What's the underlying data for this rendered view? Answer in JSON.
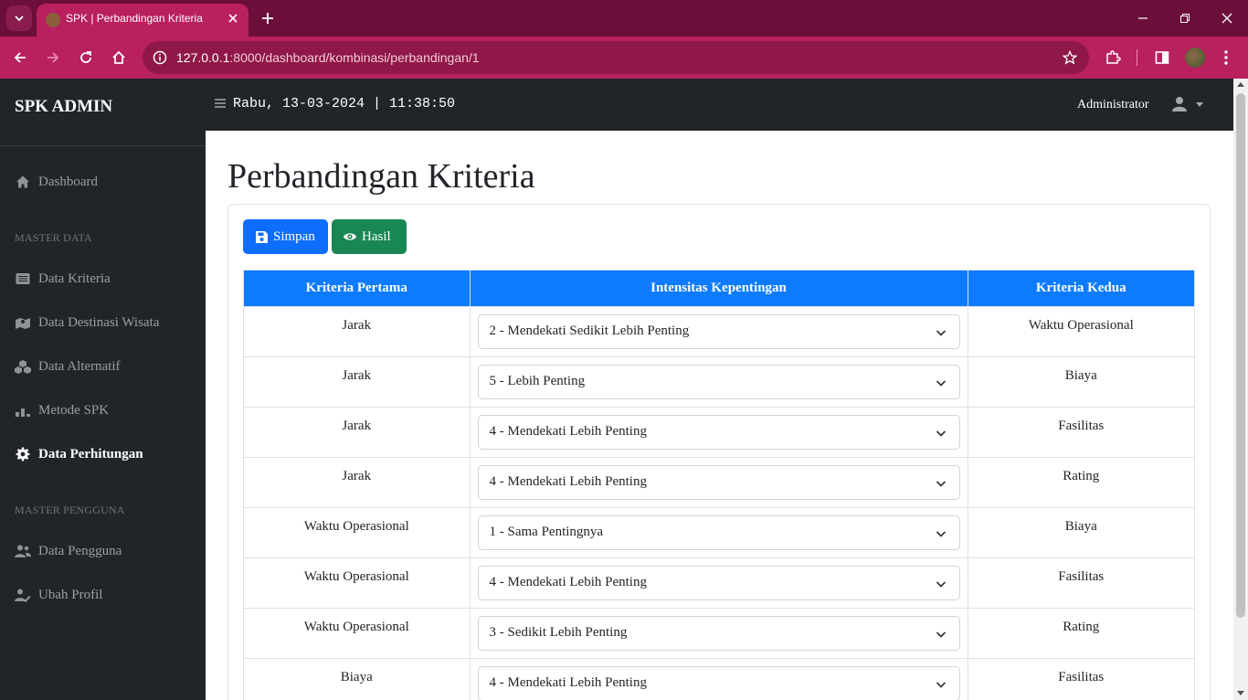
{
  "browser": {
    "tab_title": "SPK | Perbandingan Kriteria",
    "url_host": "127.0.0.1",
    "url_rest": ":8000/dashboard/kombinasi/perbandingan/1"
  },
  "sidebar": {
    "brand": "SPK ADMIN",
    "items": [
      {
        "label": "Dashboard",
        "icon": "home-icon"
      },
      {
        "heading": "MASTER DATA"
      },
      {
        "label": "Data Kriteria",
        "icon": "list-icon"
      },
      {
        "label": "Data Destinasi Wisata",
        "icon": "map-marker-icon"
      },
      {
        "label": "Data Alternatif",
        "icon": "cubes-icon"
      },
      {
        "label": "Metode SPK",
        "icon": "chart-icon"
      },
      {
        "label": "Data Perhitungan",
        "icon": "gear-icon",
        "active": true
      },
      {
        "heading": "MASTER PENGGUNA"
      },
      {
        "label": "Data Pengguna",
        "icon": "users-icon"
      },
      {
        "label": "Ubah Profil",
        "icon": "user-edit-icon"
      }
    ]
  },
  "topnav": {
    "datetime": "Rabu, 13-03-2024 | 11:38:50",
    "user": "Administrator"
  },
  "main": {
    "title": "Perbandingan Kriteria",
    "save_label": "Simpan",
    "result_label": "Hasil",
    "columns": [
      "Kriteria Pertama",
      "Intensitas Kepentingan",
      "Kriteria Kedua"
    ],
    "rows": [
      {
        "first": "Jarak",
        "intensity": "2 - Mendekati Sedikit Lebih Penting",
        "second": "Waktu Operasional"
      },
      {
        "first": "Jarak",
        "intensity": "5 - Lebih Penting",
        "second": "Biaya"
      },
      {
        "first": "Jarak",
        "intensity": "4 - Mendekati Lebih Penting",
        "second": "Fasilitas"
      },
      {
        "first": "Jarak",
        "intensity": "4 - Mendekati Lebih Penting",
        "second": "Rating"
      },
      {
        "first": "Waktu Operasional",
        "intensity": "1 - Sama Pentingnya",
        "second": "Biaya"
      },
      {
        "first": "Waktu Operasional",
        "intensity": "4 - Mendekati Lebih Penting",
        "second": "Fasilitas"
      },
      {
        "first": "Waktu Operasional",
        "intensity": "3 - Sedikit Lebih Penting",
        "second": "Rating"
      },
      {
        "first": "Biaya",
        "intensity": "4 - Mendekati Lebih Penting",
        "second": "Fasilitas"
      }
    ]
  },
  "colors": {
    "browser_frame": "#6b0f3a",
    "browser_toolbar": "#b8205e",
    "sidebar_bg": "#212529",
    "primary": "#0d6efd",
    "success": "#198754",
    "table_header": "#0d7bff"
  }
}
